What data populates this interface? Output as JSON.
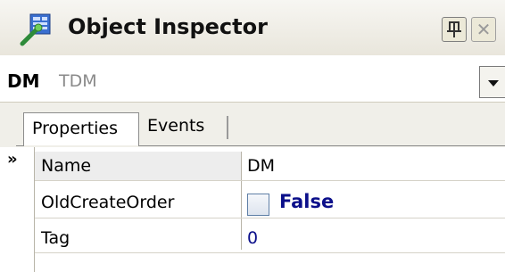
{
  "window": {
    "title": "Object Inspector",
    "icon": "object-inspector-icon",
    "pin_icon": "pin-icon",
    "close_icon": "close-icon"
  },
  "selector": {
    "component_name": "DM",
    "component_type": "TDM"
  },
  "tabs": [
    {
      "label": "Properties",
      "active": true
    },
    {
      "label": "Events",
      "active": false
    }
  ],
  "properties": [
    {
      "name": "Name",
      "value": "DM",
      "selected": true
    },
    {
      "name": "OldCreateOrder",
      "value": "False",
      "checkbox": true,
      "checked": false
    },
    {
      "name": "Tag",
      "value": "0"
    }
  ],
  "colors": {
    "value_blue": "#0b0f8a",
    "titlebar": "#ece9d8"
  }
}
